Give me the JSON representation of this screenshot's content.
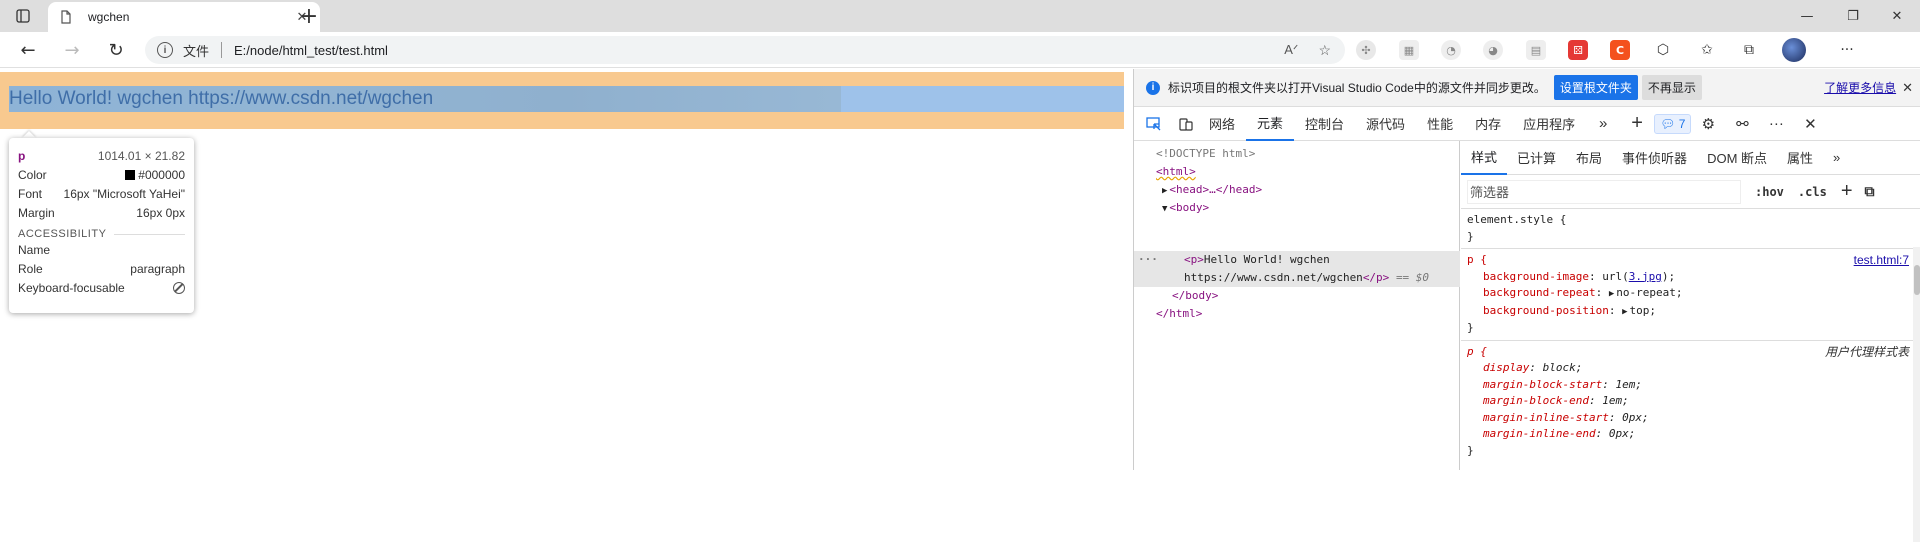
{
  "browser": {
    "tab_title": "wgchen",
    "tab_close": "✕",
    "new_tab": "+",
    "window_controls": [
      "—",
      "❐",
      "✕"
    ],
    "address": {
      "file_label": "文件",
      "url": "E:/node/html_test/test.html",
      "read_aloud": "Aᐟ",
      "favorite": "☆"
    },
    "toolbar_menu": "···"
  },
  "page": {
    "paragraph_text": "Hello World! wgchen https://www.csdn.net/wgchen"
  },
  "tooltip": {
    "tag": "p",
    "size": "1014.01 × 21.82",
    "color_label": "Color",
    "color_value": "#000000",
    "font_label": "Font",
    "font_value": "16px \"Microsoft YaHei\"",
    "margin_label": "Margin",
    "margin_value": "16px 0px",
    "accessibility_heading": "ACCESSIBILITY",
    "name_label": "Name",
    "name_value": "",
    "role_label": "Role",
    "role_value": "paragraph",
    "focus_label": "Keyboard-focusable"
  },
  "devtools": {
    "infobar": {
      "message": "标识项目的根文件夹以打开Visual Studio Code中的源文件并同步更改。",
      "set_root": "设置根文件夹",
      "dont_show": "不再显示",
      "learn_more": "了解更多信息",
      "close": "✕"
    },
    "tabs": [
      "网络",
      "元素",
      "控制台",
      "源代码",
      "性能",
      "内存",
      "应用程序"
    ],
    "active_tab": "元素",
    "more_tabs": "»",
    "add_tab": "+",
    "issues_count": "7",
    "more_menu": "···",
    "close": "✕",
    "dom": {
      "doctype": "<!DOCTYPE html>",
      "html_open": "<html>",
      "head": "<head>…</head>",
      "body_open": "<body>",
      "p_line1": "Hello World! wgchen",
      "p_line2": "https://www.csdn.net/wgchen",
      "p_open_tag": "<p>",
      "p_close_tag": "</p>",
      "eq0": "== $0",
      "dots": "···",
      "body_close": "</body>",
      "html_close": "</html>"
    },
    "styles": {
      "tabs": [
        "样式",
        "已计算",
        "布局",
        "事件侦听器",
        "DOM 断点",
        "属性"
      ],
      "more": "»",
      "filter_placeholder": "筛选器",
      "hov": ":hov",
      "cls": ".cls",
      "add": "+",
      "element_style": "element.style {",
      "close_brace": "}",
      "p_selector": "p {",
      "p_source": "test.html:7",
      "bg_image_name": "background-image",
      "bg_image_pre": "url(",
      "bg_image_link": "3.jpg",
      "bg_image_post": ");",
      "bg_repeat_name": "background-repeat",
      "bg_repeat_value": "no-repeat;",
      "bg_position_name": "background-position",
      "bg_position_value": "top;",
      "ua_source": "用户代理样式表",
      "ua_props": [
        {
          "name": "display",
          "value": "block;"
        },
        {
          "name": "margin-block-start",
          "value": "1em;"
        },
        {
          "name": "margin-block-end",
          "value": "1em;"
        },
        {
          "name": "margin-inline-start",
          "value": "0px;"
        },
        {
          "name": "margin-inline-end",
          "value": "0px;"
        }
      ]
    }
  }
}
